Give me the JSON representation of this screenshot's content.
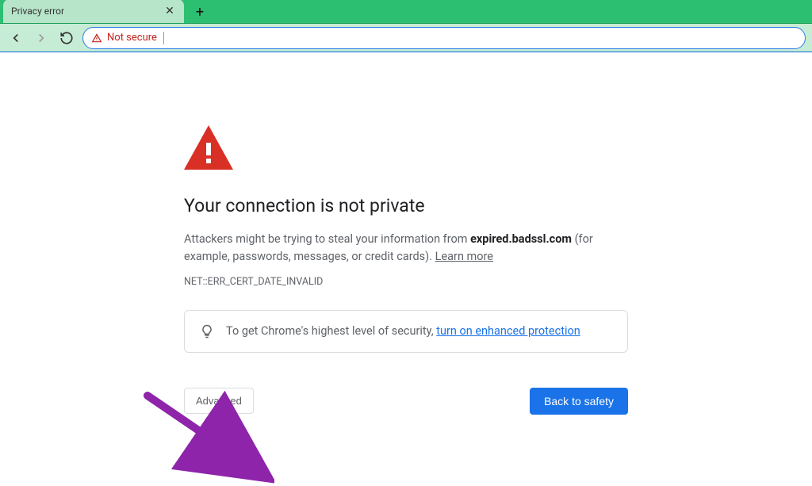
{
  "tab": {
    "title": "Privacy error"
  },
  "address_bar": {
    "warning_text": "Not secure"
  },
  "page": {
    "heading": "Your connection is not private",
    "body_prefix": "Attackers might be trying to steal your information from ",
    "body_domain": "expired.badssl.com",
    "body_suffix": " (for example, passwords, messages, or credit cards). ",
    "learn_more": "Learn more",
    "error_code": "NET::ERR_CERT_DATE_INVALID",
    "tip_prefix": "To get Chrome's highest level of security, ",
    "tip_link": "turn on enhanced protection",
    "advanced_label": "Advanced",
    "safety_label": "Back to safety"
  },
  "colors": {
    "accent_green": "#2dbf71",
    "link_blue": "#1a73e8",
    "danger_red": "#d93025"
  }
}
